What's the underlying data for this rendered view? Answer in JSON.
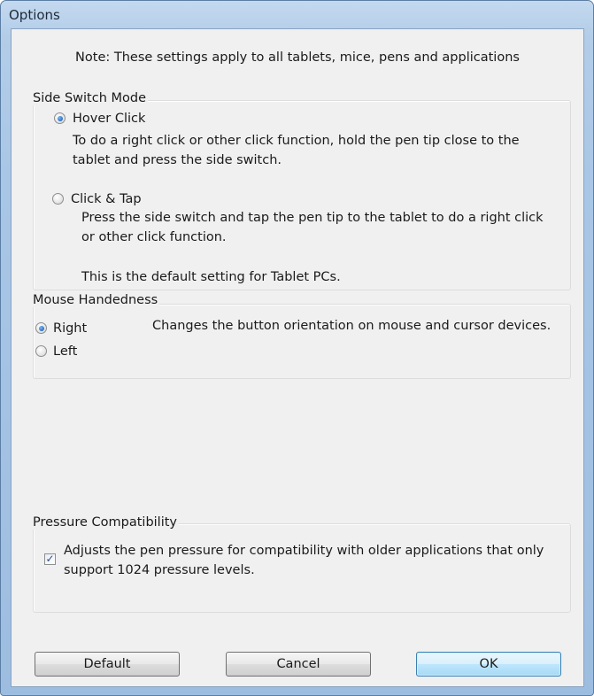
{
  "window": {
    "title": "Options"
  },
  "note": "Note: These settings apply to all tablets, mice, pens and applications",
  "side_switch": {
    "label": "Side Switch Mode",
    "hover_click": {
      "label": "Hover Click",
      "selected": true,
      "description_line1": "To do a right click or other click function, hold the pen tip close to the",
      "description_line2": "tablet and press the side switch."
    },
    "click_tap": {
      "label": "Click & Tap",
      "selected": false,
      "description_line1": "Press the side switch and tap the pen tip to the tablet to do a right click",
      "description_line2": "or other click function.",
      "default_note": "This is the default setting for Tablet PCs."
    }
  },
  "mouse_handedness": {
    "label": "Mouse Handedness",
    "right_label": "Right",
    "left_label": "Left",
    "selected": "Right",
    "description": "Changes the button orientation on mouse and cursor devices."
  },
  "pressure": {
    "label": "Pressure Compatibility",
    "checked": true,
    "description_line1": "Adjusts the pen pressure for compatibility with older applications that only",
    "description_line2": "support 1024 pressure levels."
  },
  "buttons": {
    "default_label": "Default",
    "cancel_label": "Cancel",
    "ok_label": "OK"
  }
}
